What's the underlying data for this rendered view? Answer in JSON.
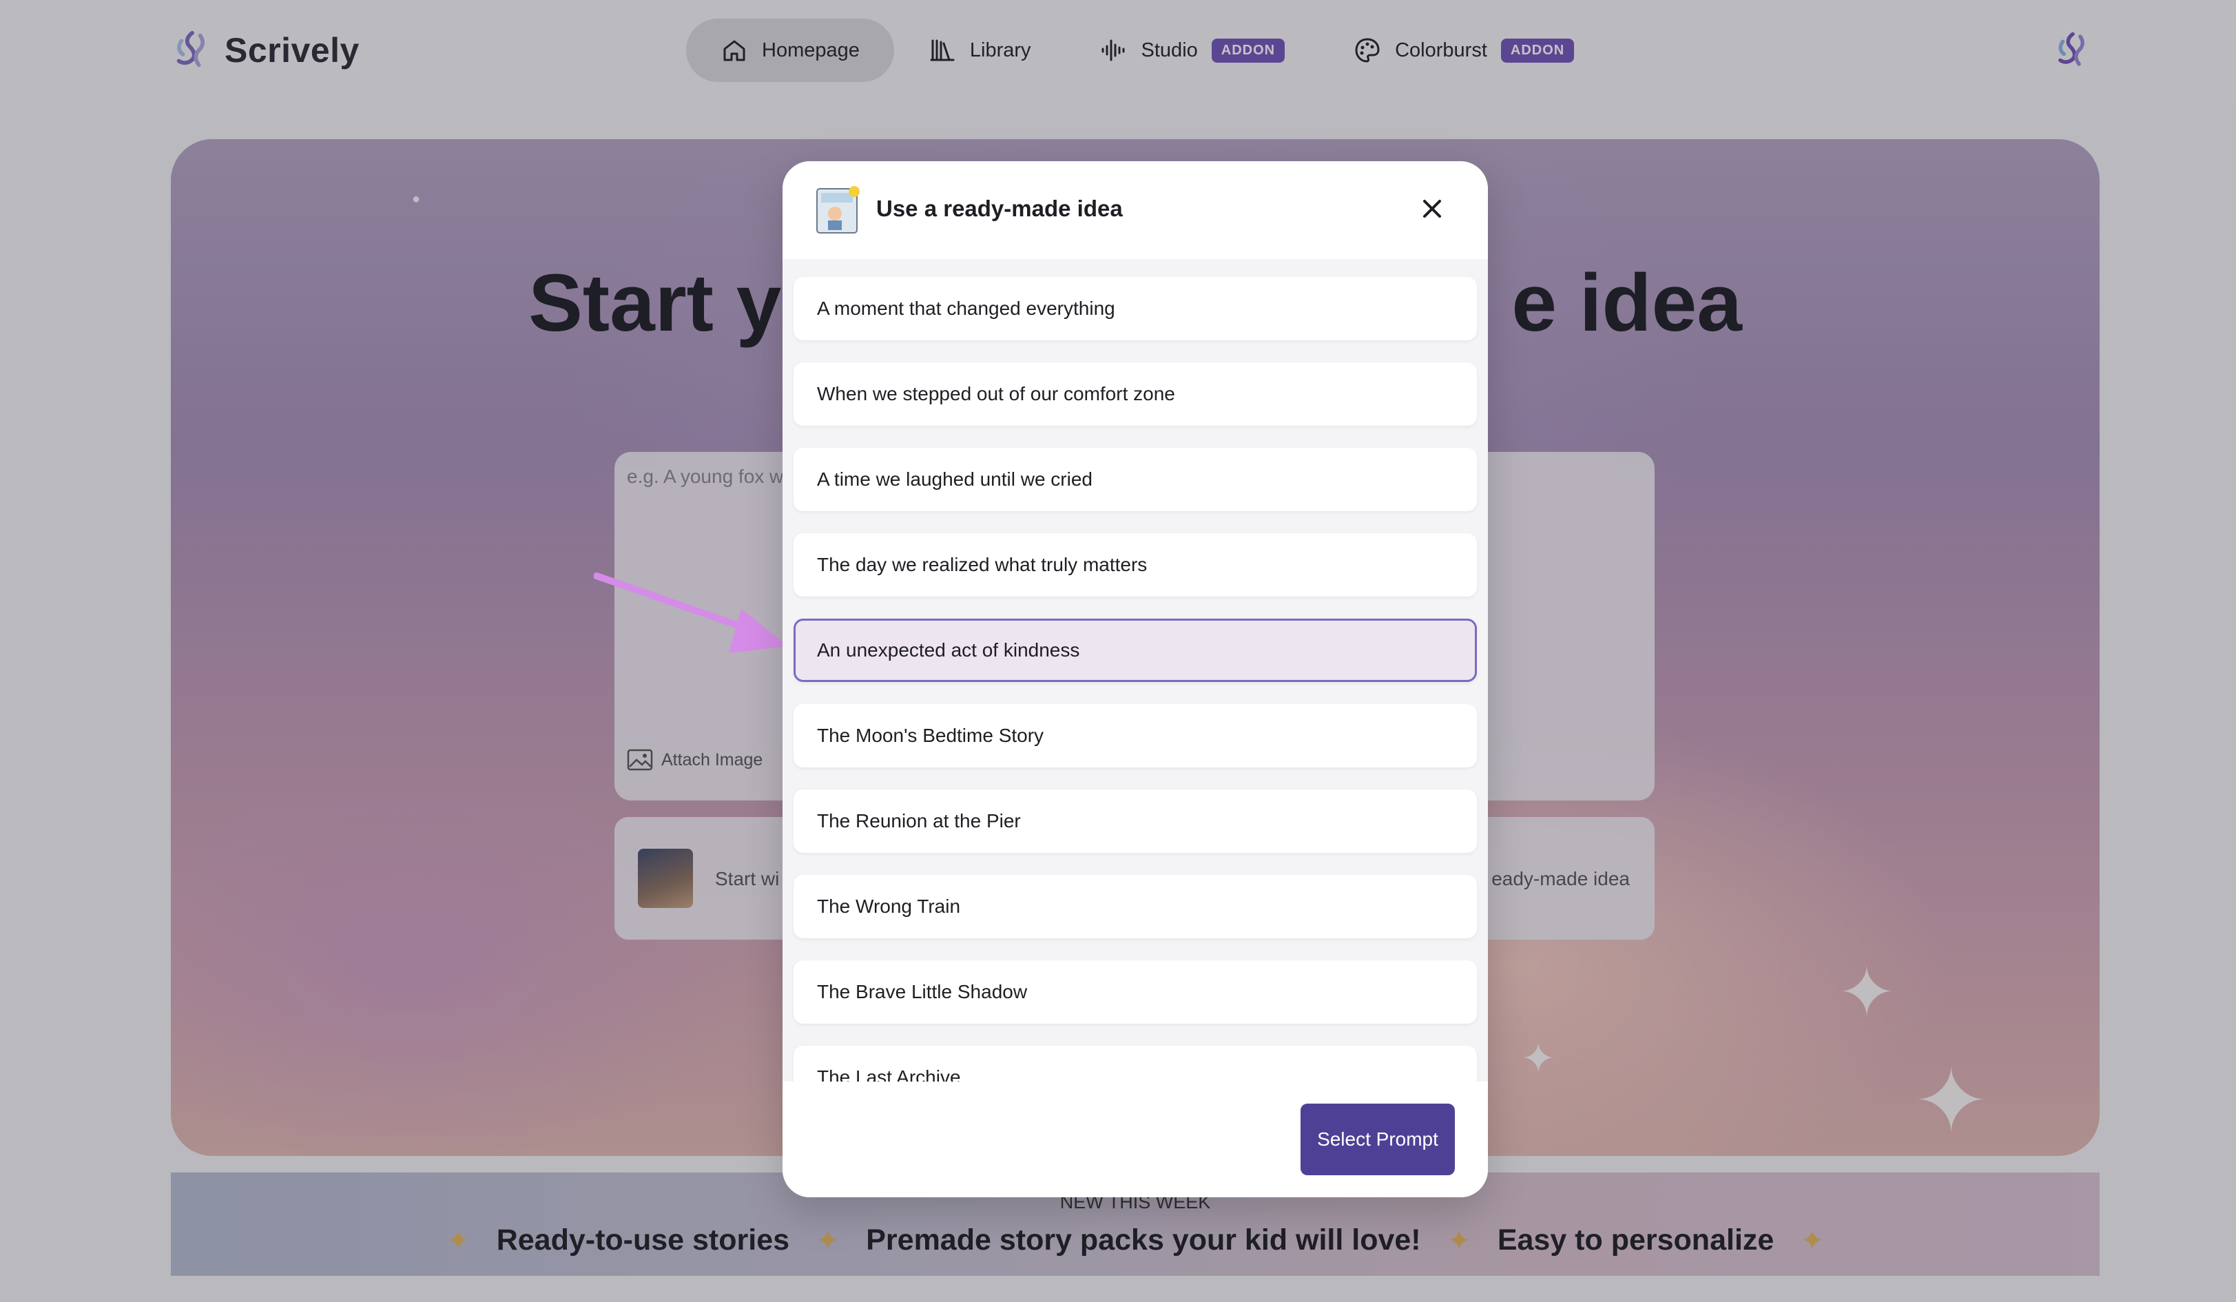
{
  "app": {
    "name": "Scrively"
  },
  "nav": {
    "items": [
      {
        "label": "Homepage",
        "icon": "home-icon",
        "active": true
      },
      {
        "label": "Library",
        "icon": "library-icon",
        "active": false
      },
      {
        "label": "Studio",
        "icon": "audio-wave-icon",
        "badge": "ADDON",
        "active": false
      },
      {
        "label": "Colorburst",
        "icon": "palette-icon",
        "badge": "ADDON",
        "active": false
      }
    ]
  },
  "hero": {
    "title_left": "Start y",
    "title_right": "e idea",
    "composer_placeholder": "e.g. A young fox w",
    "attach_label": "Attach Image",
    "option_left": "Start wi",
    "option_right": "eady-made idea"
  },
  "marquee": {
    "heading": "NEW THIS WEEK",
    "items": [
      "Ready-to-use stories",
      "Premade story packs your kid will love!",
      "Easy to personalize"
    ]
  },
  "modal": {
    "title": "Use a ready-made idea",
    "prompts": [
      {
        "label": "A moment that changed everything",
        "selected": false
      },
      {
        "label": "When we stepped out of our comfort zone",
        "selected": false
      },
      {
        "label": "A time we laughed until we cried",
        "selected": false
      },
      {
        "label": "The day we realized what truly matters",
        "selected": false
      },
      {
        "label": "An unexpected act of kindness",
        "selected": true
      },
      {
        "label": "The Moon's Bedtime Story",
        "selected": false
      },
      {
        "label": "The Reunion at the Pier",
        "selected": false
      },
      {
        "label": "The Wrong Train",
        "selected": false
      },
      {
        "label": "The Brave Little Shadow",
        "selected": false
      },
      {
        "label": "The Last Archive",
        "selected": false
      }
    ],
    "select_button": "Select Prompt"
  },
  "colors": {
    "accent": "#4e4195",
    "addon_badge": "#6f53b8",
    "selected_bg": "#ede6f1",
    "selected_border": "#7b6bc0",
    "arrow": "#d58ce8"
  }
}
